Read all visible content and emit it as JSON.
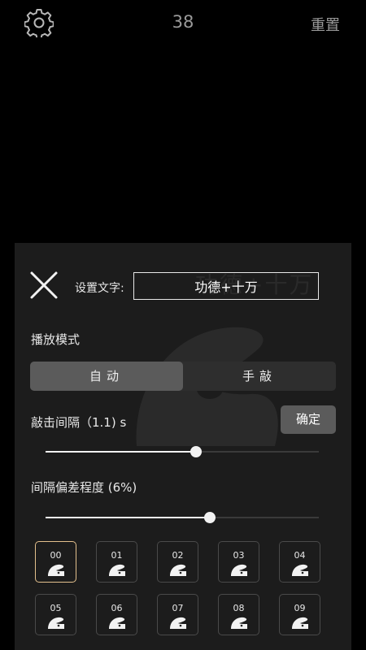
{
  "header": {
    "counter": "38",
    "reset_label": "重置"
  },
  "panel": {
    "watermark_text": "功德+十万",
    "text_label": "设置文字:",
    "text_value": "功德+十万",
    "mode_label": "播放模式",
    "mode_options": [
      "自动",
      "手敲"
    ],
    "mode_selected": "自动",
    "interval_label": "敲击间隔（1.1) s",
    "interval_value": 1.1,
    "interval_slider_fraction": 0.55,
    "confirm_label": "确定",
    "deviation_label": "间隔偏差程度 (6%)",
    "deviation_value_percent": 6,
    "deviation_slider_fraction": 0.6
  },
  "sounds": {
    "items": [
      "00",
      "01",
      "02",
      "03",
      "04",
      "05",
      "06",
      "07",
      "08",
      "09"
    ],
    "selected": "00"
  },
  "colors": {
    "background": "#000000",
    "panel": "#1c1c1c",
    "segment_active": "#5b5b5b",
    "selected_border": "#e3c08d"
  }
}
